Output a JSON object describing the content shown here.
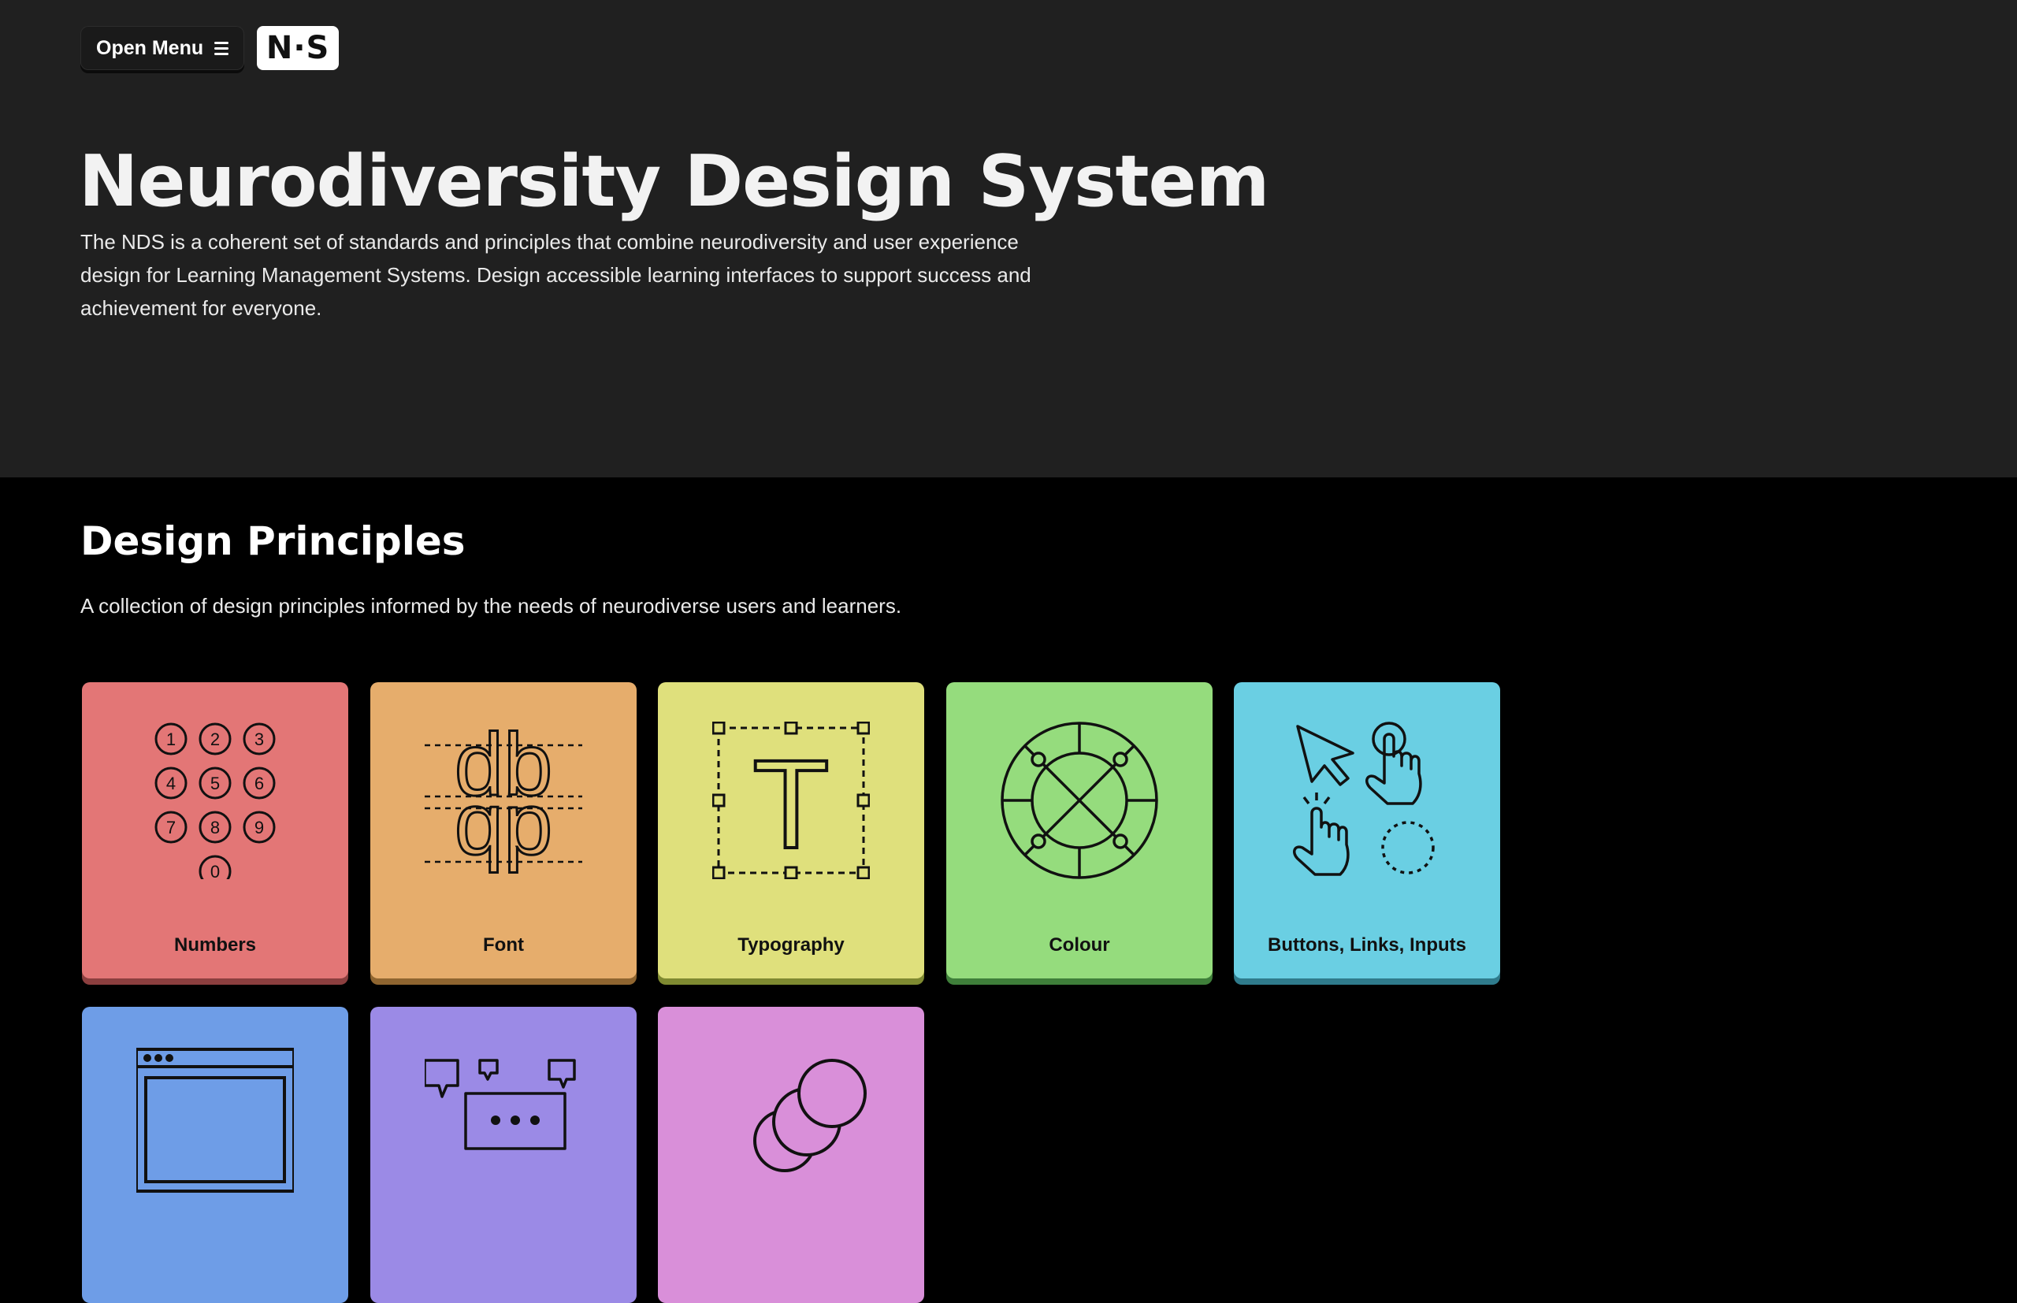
{
  "topbar": {
    "menu_label": "Open Menu",
    "logo_text": "N·S"
  },
  "hero": {
    "title": "Neurodiversity Design System",
    "intro": "The NDS is a coherent set of standards and principles that combine neurodiversity and user experience design for Learning Management Systems. Design accessible learning interfaces to support success and achievement for everyone."
  },
  "principles": {
    "title": "Design Principles",
    "description": "A collection of design principles informed by the needs of neurodiverse users and learners.",
    "cards": [
      {
        "label": "Numbers",
        "icon": "number-keypad-icon",
        "color": "#e37676"
      },
      {
        "label": "Font",
        "icon": "font-letters-icon",
        "color": "#e6ad6c"
      },
      {
        "label": "Typography",
        "icon": "text-box-icon",
        "color": "#dfe07c"
      },
      {
        "label": "Colour",
        "icon": "colour-wheel-icon",
        "color": "#95dc7d"
      },
      {
        "label": "Buttons, Links, Inputs",
        "icon": "pointer-hand-icon",
        "color": "#6acfe3"
      },
      {
        "label": "",
        "icon": "browser-window-icon",
        "color": "#6e9de7"
      },
      {
        "label": "",
        "icon": "speech-bubbles-icon",
        "color": "#9b8ae6"
      },
      {
        "label": "",
        "icon": "circles-icon",
        "color": "#d98fd9"
      }
    ]
  },
  "keypad": [
    "1",
    "2",
    "3",
    "4",
    "5",
    "6",
    "7",
    "8",
    "9",
    "0"
  ],
  "font_glyphs": {
    "top": "db",
    "bottom": "qp"
  },
  "typo_glyph": "T"
}
